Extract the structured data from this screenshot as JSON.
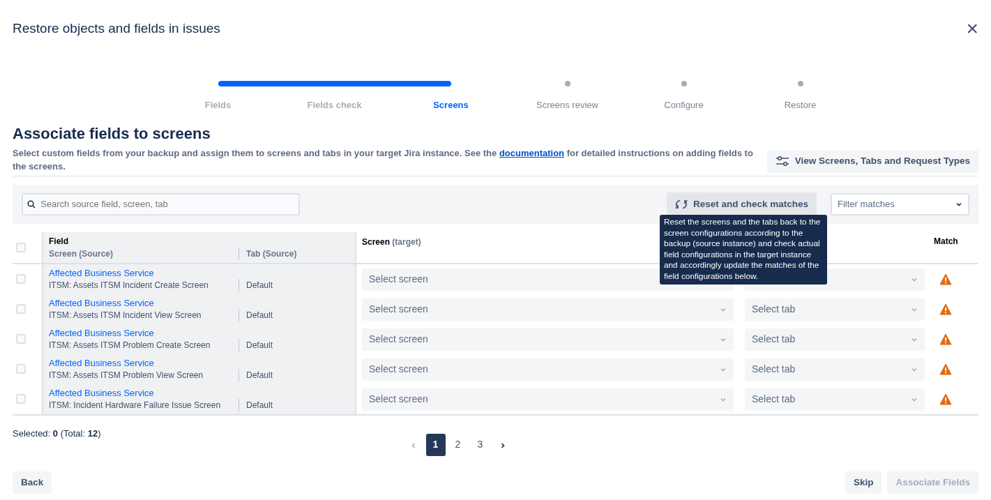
{
  "dialog": {
    "title": "Restore objects and fields in issues",
    "close_label": "×"
  },
  "stepper": [
    {
      "label": "Fields",
      "completed": true,
      "selected": false
    },
    {
      "label": "Fields check",
      "completed": true,
      "selected": false
    },
    {
      "label": "Screens",
      "completed": false,
      "selected": true
    },
    {
      "label": "Screens review",
      "completed": false,
      "selected": false
    },
    {
      "label": "Configure",
      "completed": false,
      "selected": false
    },
    {
      "label": "Restore",
      "completed": false,
      "selected": false
    }
  ],
  "heading": "Associate fields to screens",
  "description": {
    "before": "Select custom fields from your backup and assign them to screens and tabs in your target Jira instance. See the ",
    "link": "documentation",
    "after": " for detailed instructions on adding fields to the screens."
  },
  "view_button": "View Screens, Tabs and Request Types",
  "toolbar": {
    "search_placeholder": "Search source field, screen, tab",
    "reset_button": "Reset and check matches",
    "filter_placeholder": "Filter matches"
  },
  "tooltip": "Reset the screens and the tabs back to the screen configurations according to the backup (source instance) and check actual field configurations in the target instance and accordingly update the matches of the field configurations below.",
  "table": {
    "header_checked": false,
    "columns": {
      "field": "Field",
      "screen_source": "Screen (Source)",
      "tab_source": "Tab (Source)",
      "screen_target": "Screen",
      "screen_target_note": "(target)",
      "match": "Match"
    },
    "rows": [
      {
        "checked": false,
        "field": "Affected Business Service",
        "screen_source": "ITSM: Assets ITSM Incident Create Screen",
        "tab_source": "Default",
        "screen_placeholder": "Select screen",
        "match_warning": true
      },
      {
        "checked": false,
        "field": "Affected Business Service",
        "screen_source": "ITSM: Assets ITSM Incident View Screen",
        "tab_source": "Default",
        "screen_placeholder": "Select screen",
        "tab_placeholder": "Select tab",
        "match_warning": true
      },
      {
        "checked": false,
        "field": "Affected Business Service",
        "screen_source": "ITSM: Assets ITSM Problem Create Screen",
        "tab_source": "Default",
        "screen_placeholder": "Select screen",
        "tab_placeholder": "Select tab",
        "match_warning": true
      },
      {
        "checked": false,
        "field": "Affected Business Service",
        "screen_source": "ITSM: Assets ITSM Problem View Screen",
        "tab_source": "Default",
        "screen_placeholder": "Select screen",
        "tab_placeholder": "Select tab",
        "match_warning": true
      },
      {
        "checked": false,
        "field": "Affected Business Service",
        "screen_source": "ITSM: Incident Hardware Failure Issue Screen",
        "tab_source": "Default",
        "screen_placeholder": "Select screen",
        "tab_placeholder": "Select tab",
        "match_warning": true
      }
    ]
  },
  "selection_summary": "Selected: **0** (Total: **12**)",
  "pagination": [
    {
      "label": "1",
      "selected": true
    },
    {
      "label": "2",
      "selected": false
    },
    {
      "label": "3",
      "selected": false
    }
  ],
  "footer": {
    "back": "Back",
    "skip": "Skip",
    "associate": "Associate Fields",
    "associate_disabled": true
  }
}
